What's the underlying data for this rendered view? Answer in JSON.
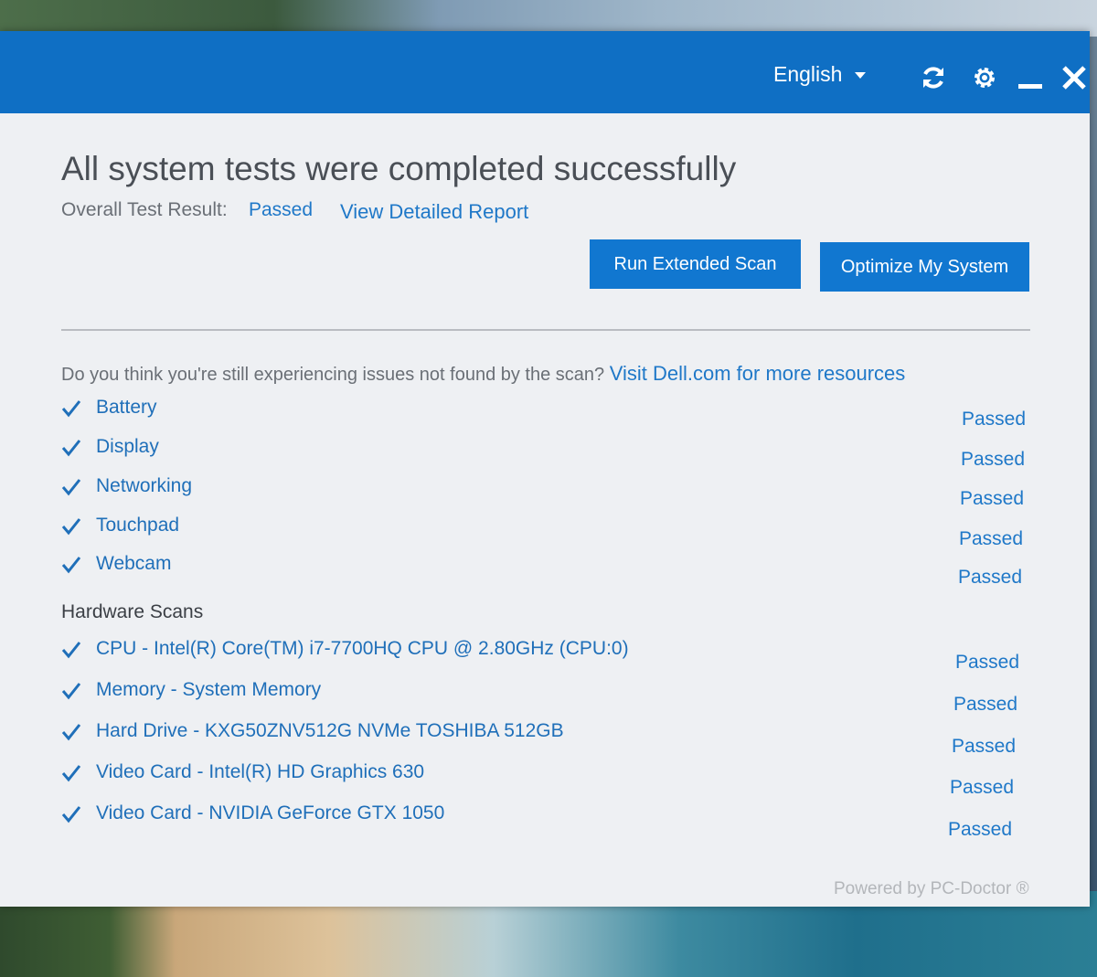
{
  "header": {
    "language": "English",
    "refresh_icon": "refresh-icon",
    "settings_icon": "gear-icon",
    "minimize_icon": "minimize-icon",
    "close_icon": "close-icon",
    "accent": "#0f6fc4"
  },
  "summary": {
    "title": "All system tests were completed successfully",
    "overall_label": "Overall Test Result:",
    "overall_value": "Passed",
    "report_link": "View Detailed Report"
  },
  "actions": {
    "extended_scan": "Run Extended Scan",
    "optimize": "Optimize My System"
  },
  "help": {
    "question": "Do you think you're still experiencing issues not found by the scan? ",
    "link": "Visit Dell.com for more resources"
  },
  "tests": [
    {
      "label": "Battery",
      "status": "Passed"
    },
    {
      "label": "Display",
      "status": "Passed"
    },
    {
      "label": "Networking",
      "status": "Passed"
    },
    {
      "label": "Touchpad",
      "status": "Passed"
    },
    {
      "label": "Webcam",
      "status": "Passed"
    }
  ],
  "hardware": {
    "title": "Hardware Scans",
    "items": [
      {
        "label": "CPU - Intel(R) Core(TM) i7-7700HQ CPU @ 2.80GHz (CPU:0)",
        "status": "Passed"
      },
      {
        "label": "Memory - System Memory",
        "status": "Passed"
      },
      {
        "label": "Hard Drive - KXG50ZNV512G NVMe TOSHIBA 512GB",
        "status": "Passed"
      },
      {
        "label": "Video Card - Intel(R) HD Graphics 630",
        "status": "Passed"
      },
      {
        "label": "Video Card - NVIDIA GeForce GTX 1050",
        "status": "Passed"
      }
    ]
  },
  "footer": "Powered by PC-Doctor ®"
}
